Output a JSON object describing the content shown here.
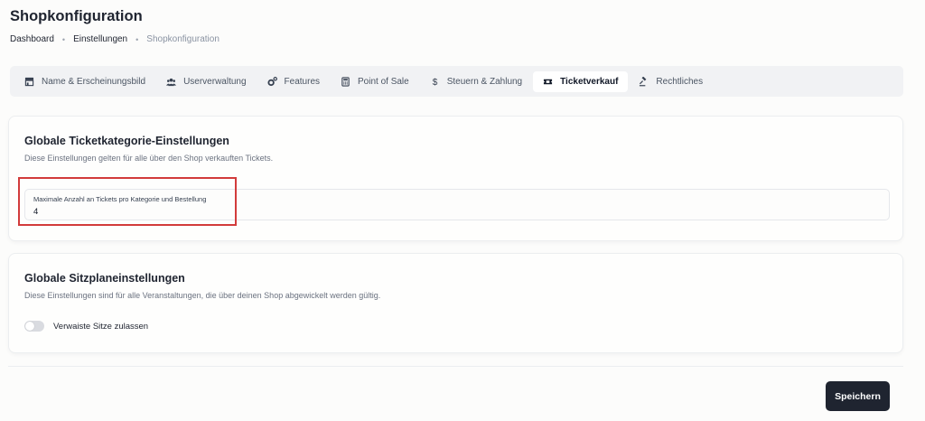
{
  "page": {
    "title": "Shopkonfiguration"
  },
  "breadcrumb": {
    "items": [
      "Dashboard",
      "Einstellungen",
      "Shopkonfiguration"
    ]
  },
  "tabs": [
    {
      "label": "Name & Erscheinungsbild",
      "icon": "storefront-icon",
      "active": false
    },
    {
      "label": "Userverwaltung",
      "icon": "users-icon",
      "active": false
    },
    {
      "label": "Features",
      "icon": "gears-icon",
      "active": false
    },
    {
      "label": "Point of Sale",
      "icon": "cash-register-icon",
      "active": false
    },
    {
      "label": "Steuern & Zahlung",
      "icon": "dollar-icon",
      "active": false
    },
    {
      "label": "Ticketverkauf",
      "icon": "ticket-icon",
      "active": true
    },
    {
      "label": "Rechtliches",
      "icon": "gavel-icon",
      "active": false
    }
  ],
  "ticket_settings": {
    "title": "Globale Ticketkategorie-Einstellungen",
    "description": "Diese Einstellungen gelten für alle über den Shop verkauften Tickets.",
    "max_tickets": {
      "label": "Maximale Anzahl an Tickets pro Kategorie und Bestellung",
      "value": "4"
    }
  },
  "seating_settings": {
    "title": "Globale Sitzplaneinstellungen",
    "description": "Diese Einstellungen sind für alle Veranstaltungen, die über deinen Shop abgewickelt werden gültig.",
    "orphan_seats": {
      "label": "Verwaiste Sitze zulassen",
      "enabled": false
    }
  },
  "actions": {
    "save_label": "Speichern"
  },
  "colors": {
    "primary_button": "#1f2430",
    "highlight_border": "#d23b3b",
    "tab_bar_bg": "#f1f2f4"
  }
}
